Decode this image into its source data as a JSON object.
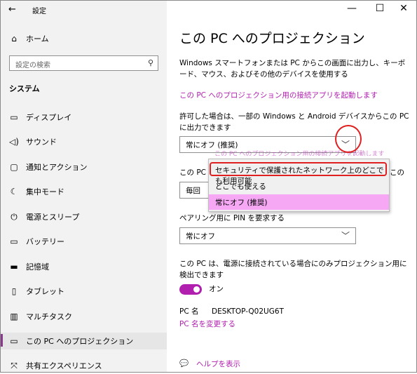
{
  "window": {
    "title": "設定",
    "back_icon": "←",
    "minimize": "—",
    "maximize": "☐",
    "close": "✕"
  },
  "sidebar": {
    "home": {
      "label": "ホーム",
      "icon": "⌂"
    },
    "search": {
      "placeholder": "設定の検索",
      "icon": "⚲"
    },
    "section": "システム",
    "items": [
      {
        "label": "ディスプレイ",
        "icon": "▭"
      },
      {
        "label": "サウンド",
        "icon": "◁)"
      },
      {
        "label": "通知とアクション",
        "icon": "▢"
      },
      {
        "label": "集中モード",
        "icon": "☾"
      },
      {
        "label": "電源とスリープ",
        "icon": "⏻"
      },
      {
        "label": "バッテリー",
        "icon": "▭"
      },
      {
        "label": "記憶域",
        "icon": "▬"
      },
      {
        "label": "タブレット",
        "icon": "▯"
      },
      {
        "label": "マルチタスク",
        "icon": "▥"
      },
      {
        "label": "この PC へのプロジェクション",
        "icon": "▭"
      },
      {
        "label": "共有エクスペリエンス",
        "icon": "⤧"
      }
    ]
  },
  "main": {
    "title": "この PC へのプロジェクション",
    "description": "Windows スマートフォンまたは PC からこの画面に出力し、キーボード、マウス、およびその他のデバイスを使用する",
    "launch_link": "この PC へのプロジェクション用の接続アプリを起動します",
    "allow_label": "許可した場合は、一部の Windows と Android デバイスからこの PC に出力できます",
    "allow_value": "常にオフ (推奨)",
    "obscured_link": "この PC へのプロジェクション用の接続アプリを起動します",
    "ask_label_start": "この PC",
    "ask_label_end": "この",
    "ask_value_start": "毎回",
    "pin_label": "ペアリング用に PIN を要求する",
    "pin_value": "常にオフ",
    "power_label": "この PC は、電源に接続されている場合にのみプロジェクション用に検出できます",
    "power_toggle": "オン",
    "pc_name_label": "PC 名",
    "pc_name_value": "DESKTOP-Q02UG6T",
    "rename_link": "PC 名を変更する",
    "help_link": "ヘルプを表示",
    "help_icon": "💬"
  },
  "dropdown_options": [
    "セキュリティで保護されたネットワーク上のどこでも利用可能",
    "どこでも使える",
    "常にオフ (推奨)"
  ],
  "colors": {
    "accent": "#b01fae",
    "selected_option": "#f6a8f5",
    "annotation": "#e02020"
  }
}
